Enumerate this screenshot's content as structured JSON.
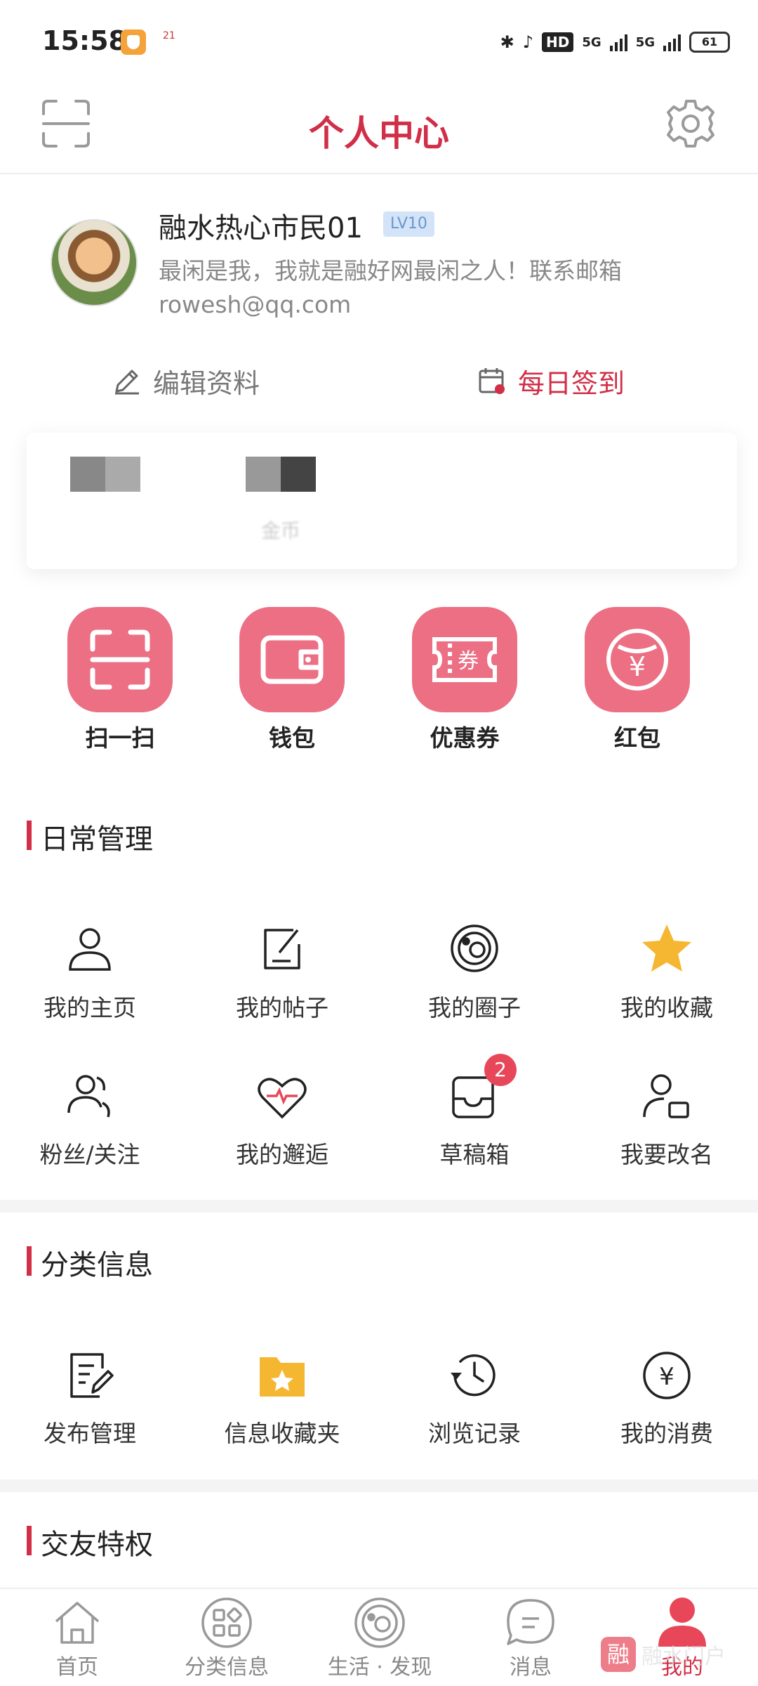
{
  "status_bar": {
    "time": "15:58",
    "mini_app_text": "21",
    "hd_label": "HD",
    "net1": "5G",
    "net2": "5G",
    "battery": "61"
  },
  "header": {
    "title": "个人中心"
  },
  "profile": {
    "username": "融水热心市民01",
    "level": "LV10",
    "bio": "最闲是我，我就是融好网最闲之人！联系邮箱rowesh@qq.com"
  },
  "actions": {
    "edit": "编辑资料",
    "sign_in": "每日签到"
  },
  "stats": {
    "blurred_label": "金币"
  },
  "quick_actions": [
    {
      "label": "扫一扫",
      "icon": "scan-icon"
    },
    {
      "label": "钱包",
      "icon": "wallet-icon"
    },
    {
      "label": "优惠券",
      "icon": "coupon-icon",
      "glyph": "券"
    },
    {
      "label": "红包",
      "icon": "red-packet-icon",
      "glyph": "¥"
    }
  ],
  "daily": {
    "title": "日常管理",
    "items": [
      {
        "label": "我的主页",
        "icon": "user-icon"
      },
      {
        "label": "我的帖子",
        "icon": "post-icon"
      },
      {
        "label": "我的圈子",
        "icon": "circle-icon"
      },
      {
        "label": "我的收藏",
        "icon": "star-icon"
      },
      {
        "label": "粉丝/关注",
        "icon": "fans-icon"
      },
      {
        "label": "我的邂逅",
        "icon": "heart-icon"
      },
      {
        "label": "草稿箱",
        "icon": "draft-icon",
        "badge": "2"
      },
      {
        "label": "我要改名",
        "icon": "rename-icon"
      }
    ]
  },
  "classified": {
    "title": "分类信息",
    "items": [
      {
        "label": "发布管理",
        "icon": "publish-icon"
      },
      {
        "label": "信息收藏夹",
        "icon": "folder-star-icon"
      },
      {
        "label": "浏览记录",
        "icon": "history-icon"
      },
      {
        "label": "我的消费",
        "icon": "yuan-icon",
        "glyph": "¥"
      }
    ]
  },
  "friends": {
    "title": "交友特权"
  },
  "bottom_nav": [
    {
      "label": "首页",
      "icon": "home-icon"
    },
    {
      "label": "分类信息",
      "icon": "category-icon"
    },
    {
      "label": "生活 · 发现",
      "icon": "discover-icon"
    },
    {
      "label": "消息",
      "icon": "message-icon"
    },
    {
      "label": "我的",
      "icon": "profile-icon",
      "active": true
    }
  ],
  "watermark": {
    "logo": "融",
    "text": "融水门户"
  },
  "colors": {
    "accent": "#d12e47",
    "quick_bg": "#ec6f84",
    "star": "#f5b731"
  }
}
